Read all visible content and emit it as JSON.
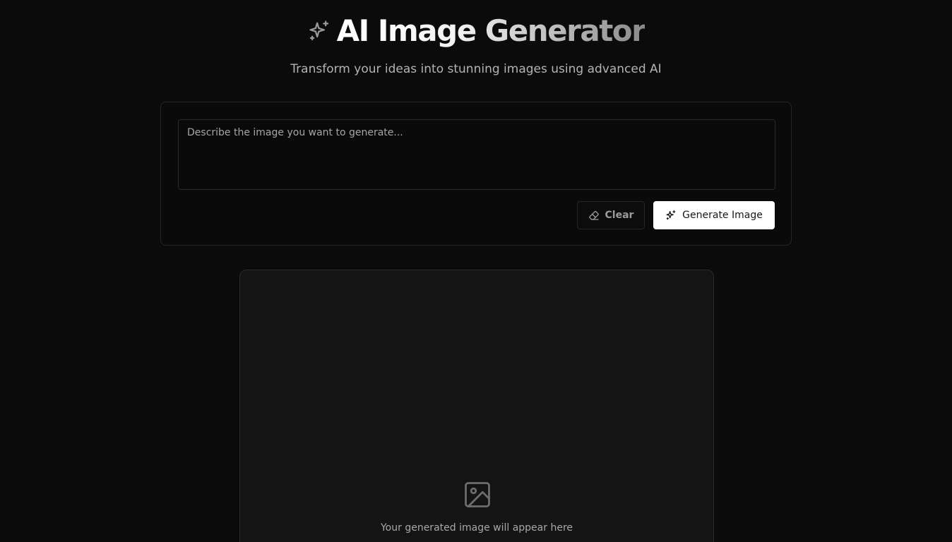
{
  "header": {
    "title": "AI Image Generator",
    "title_icon": "sparkles-icon",
    "subtitle": "Transform your ideas into stunning images using advanced AI"
  },
  "form": {
    "prompt_placeholder": "Describe the image you want to generate...",
    "prompt_value": "",
    "clear_label": "Clear",
    "clear_icon": "eraser-icon",
    "generate_label": "Generate Image",
    "generate_icon": "sparkles-icon"
  },
  "preview": {
    "placeholder_icon": "image-icon",
    "placeholder_text": "Your generated image will appear here"
  },
  "colors": {
    "background": "#0b0b0b",
    "card_border": "#262626",
    "primary_button": "#ffffff",
    "preview_background": "#141414"
  }
}
